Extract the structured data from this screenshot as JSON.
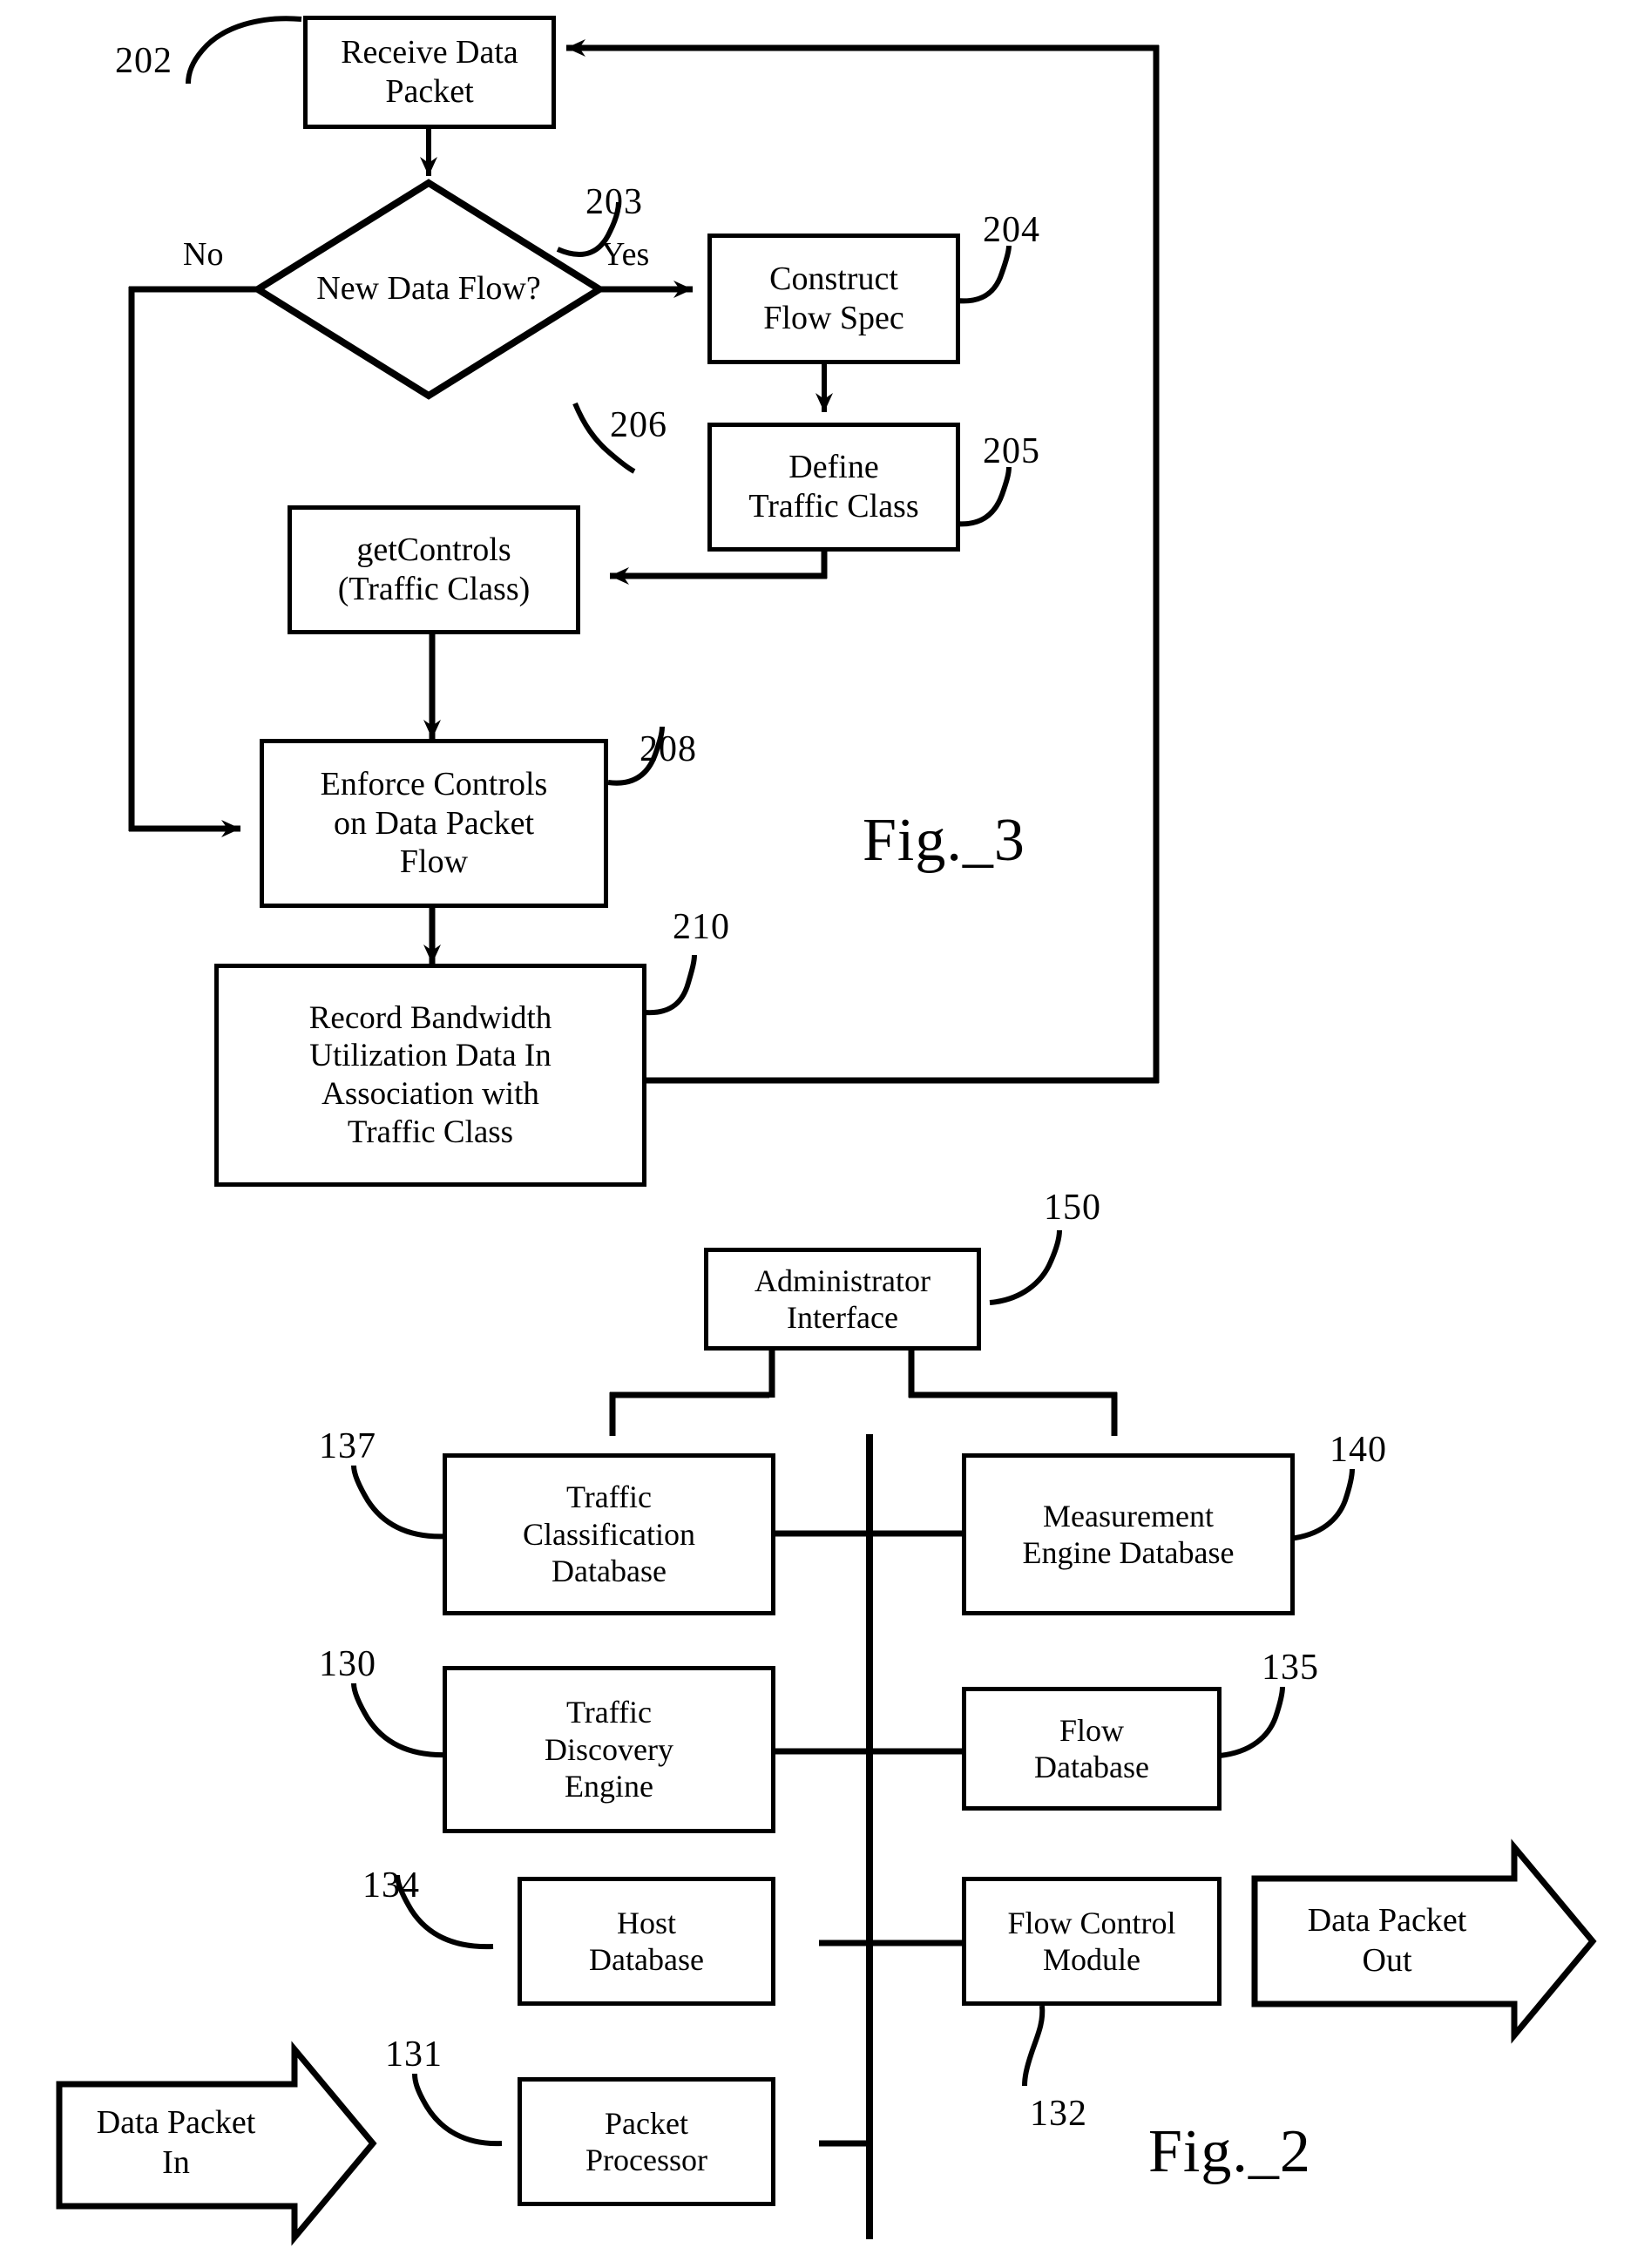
{
  "document": {
    "type": "patent-drawing-sheet",
    "figures": [
      "Fig._3",
      "Fig._2"
    ]
  },
  "fig3": {
    "label": "Fig._3",
    "nodes": [
      {
        "id": "202",
        "ref": "202",
        "text": "Receive Data Packet",
        "lines": [
          "Receive Data",
          "Packet"
        ],
        "shape": "rect"
      },
      {
        "id": "203",
        "ref": "203",
        "text": "New Data Flow?",
        "lines": [
          "New Data",
          "Flow?"
        ],
        "shape": "diamond"
      },
      {
        "id": "204",
        "ref": "204",
        "text": "Construct Flow Spec",
        "lines": [
          "Construct",
          "Flow Spec"
        ],
        "shape": "rect"
      },
      {
        "id": "205",
        "ref": "205",
        "text": "Define Traffic Class",
        "lines": [
          "Define",
          "Traffic Class"
        ],
        "shape": "rect"
      },
      {
        "id": "206",
        "ref": "206",
        "text": "getControls (Traffic Class)",
        "lines": [
          "getControls",
          "(Traffic Class)"
        ],
        "shape": "rect"
      },
      {
        "id": "208",
        "ref": "208",
        "text": "Enforce Controls on Data Packet Flow",
        "lines": [
          "Enforce Controls",
          "on Data Packet",
          "Flow"
        ],
        "shape": "rect"
      },
      {
        "id": "210",
        "ref": "210",
        "text": "Record Bandwidth Utilization Data In Association with Traffic Class",
        "lines": [
          "Record Bandwidth",
          "Utilization Data In",
          "Association with",
          "Traffic Class"
        ],
        "shape": "rect"
      }
    ],
    "branch_labels": {
      "no": "No",
      "yes": "Yes"
    }
  },
  "fig2": {
    "label": "Fig._2",
    "nodes": [
      {
        "id": "150",
        "ref": "150",
        "text": "Administrator Interface",
        "lines": [
          "Administrator",
          "Interface"
        ],
        "shape": "rect"
      },
      {
        "id": "137",
        "ref": "137",
        "text": "Traffic Classification Database",
        "lines": [
          "Traffic",
          "Classification",
          "Database"
        ],
        "shape": "rect"
      },
      {
        "id": "140",
        "ref": "140",
        "text": "Measurement Engine Database",
        "lines": [
          "Measurement",
          "Engine Database"
        ],
        "shape": "rect"
      },
      {
        "id": "130",
        "ref": "130",
        "text": "Traffic Discovery Engine",
        "lines": [
          "Traffic",
          "Discovery",
          "Engine"
        ],
        "shape": "rect"
      },
      {
        "id": "135",
        "ref": "135",
        "text": "Flow Database",
        "lines": [
          "Flow",
          "Database"
        ],
        "shape": "rect"
      },
      {
        "id": "134",
        "ref": "134",
        "text": "Host Database",
        "lines": [
          "Host",
          "Database"
        ],
        "shape": "rect"
      },
      {
        "id": "132",
        "ref": "132",
        "text": "Flow Control Module",
        "lines": [
          "Flow Control",
          "Module"
        ],
        "shape": "rect"
      },
      {
        "id": "131",
        "ref": "131",
        "text": "Packet Processor",
        "lines": [
          "Packet",
          "Processor"
        ],
        "shape": "rect"
      }
    ],
    "arrows": [
      {
        "id": "packet-in",
        "text": "Data Packet In",
        "lines": [
          "Data Packet",
          "In"
        ],
        "direction": "right"
      },
      {
        "id": "packet-out",
        "text": "Data Packet Out",
        "lines": [
          "Data Packet",
          "Out"
        ],
        "direction": "right"
      }
    ]
  },
  "colors": {
    "ink": "#000000",
    "paper": "#ffffff"
  }
}
